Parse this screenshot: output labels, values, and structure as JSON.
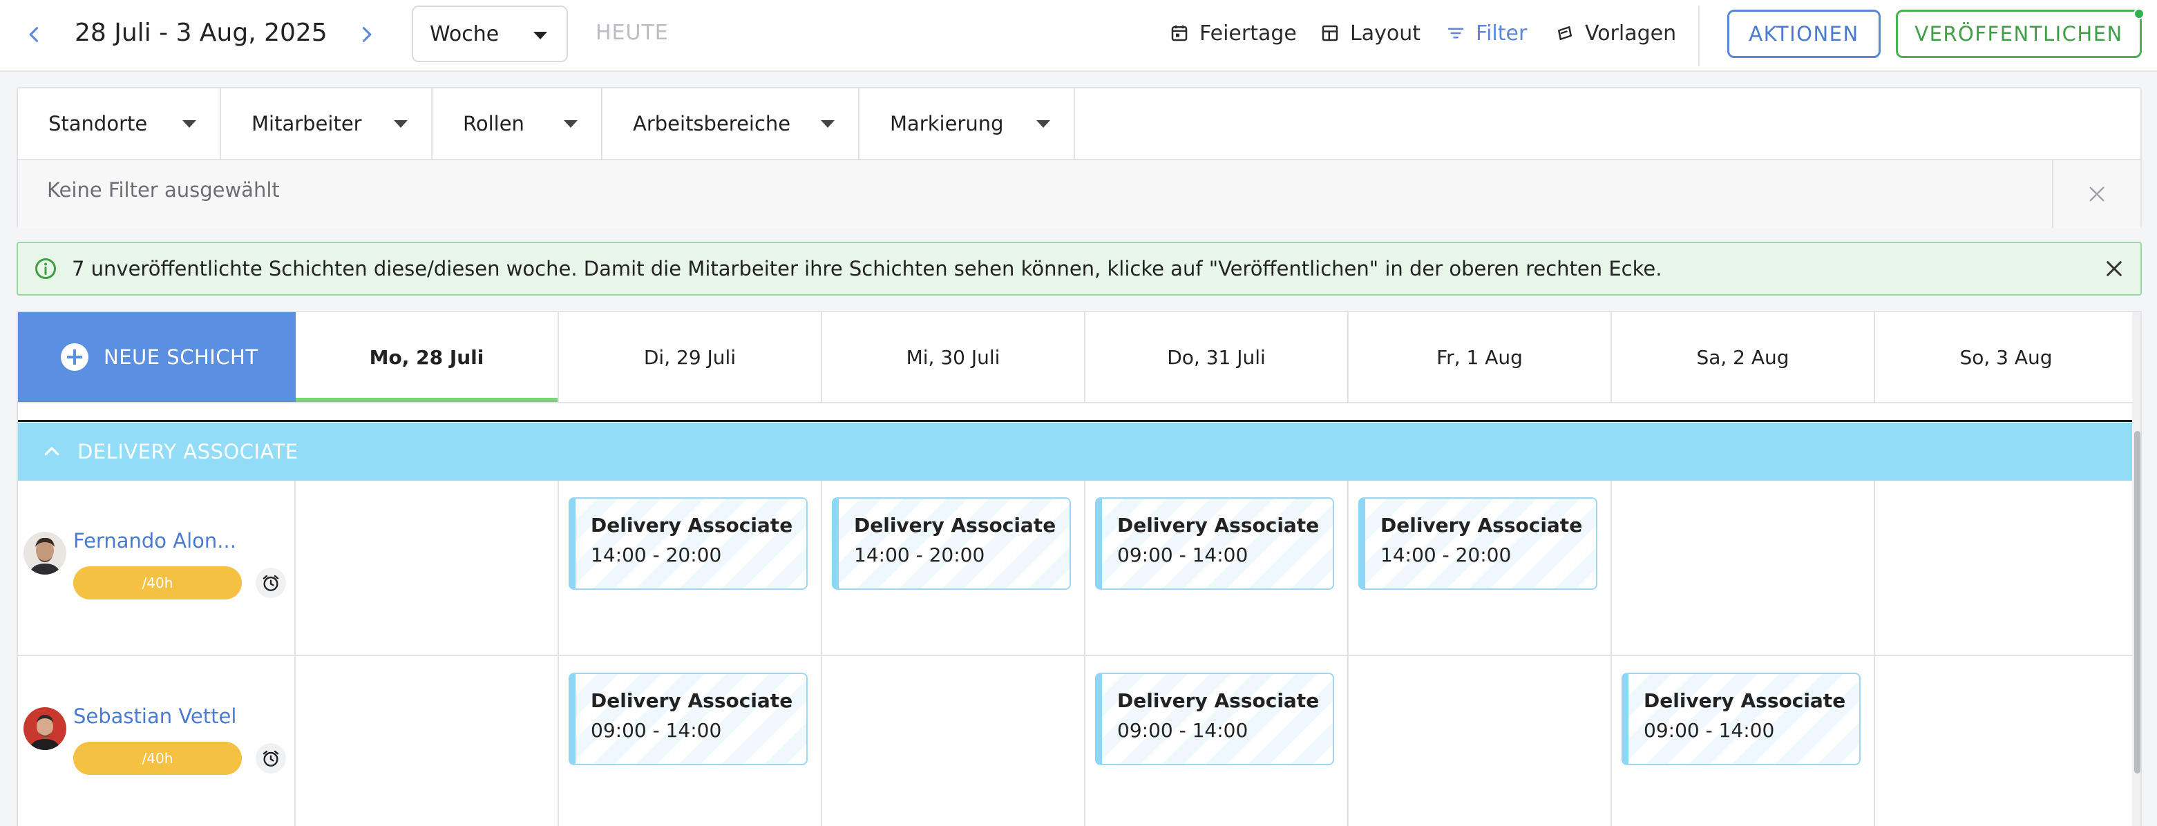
{
  "toolbar": {
    "date_range": "28 Juli - 3 Aug, 2025",
    "view_select": "Woche",
    "today": "HEUTE",
    "holidays": "Feiertage",
    "layout": "Layout",
    "filter": "Filter",
    "templates": "Vorlagen",
    "actions": "AKTIONEN",
    "publish": "VERÖFFENTLICHEN",
    "icons": [
      "chevron-left-icon",
      "chevron-right-icon",
      "calendar-icon",
      "layout-icon",
      "filter-icon",
      "template-icon"
    ]
  },
  "filters": {
    "dropdowns": [
      "Standorte",
      "Mitarbeiter",
      "Rollen",
      "Arbeitsbereiche",
      "Markierung"
    ],
    "status": "Keine Filter ausgewählt"
  },
  "banner": {
    "message": "7 unveröffentlichte Schichten diese/diesen woche. Damit die Mitarbeiter ihre Schichten sehen können, klicke auf \"Veröffentlichen\" in der oberen rechten Ecke."
  },
  "schedule": {
    "new_shift": "NEUE SCHICHT",
    "days": [
      "Mo, 28 Juli",
      "Di, 29 Juli",
      "Mi, 30 Juli",
      "Do, 31 Juli",
      "Fr, 1 Aug",
      "Sa, 2 Aug",
      "So, 3 Aug"
    ],
    "group": "DELIVERY ASSOCIATE",
    "employees": [
      {
        "name": "Fernando Alon...",
        "hours": "/40h",
        "shifts": [
          null,
          {
            "title": "Delivery Associate",
            "time": "14:00 - 20:00"
          },
          {
            "title": "Delivery Associate",
            "time": "14:00 - 20:00"
          },
          {
            "title": "Delivery Associate",
            "time": "09:00 - 14:00"
          },
          {
            "title": "Delivery Associate",
            "time": "14:00 - 20:00"
          },
          null,
          null
        ]
      },
      {
        "name": "Sebastian Vettel",
        "hours": "/40h",
        "shifts": [
          null,
          {
            "title": "Delivery Associate",
            "time": "09:00 - 14:00"
          },
          null,
          {
            "title": "Delivery Associate",
            "time": "09:00 - 14:00"
          },
          null,
          {
            "title": "Delivery Associate",
            "time": "09:00 - 14:00"
          },
          null
        ]
      }
    ]
  },
  "colors": {
    "accent_blue": "#5b87d6",
    "publish_green": "#4caf50",
    "group_bar": "#93dcf8",
    "hours_pill": "#f5c142",
    "new_shift_bg": "#5b8fe0",
    "banner_bg": "#e8f6ea"
  }
}
